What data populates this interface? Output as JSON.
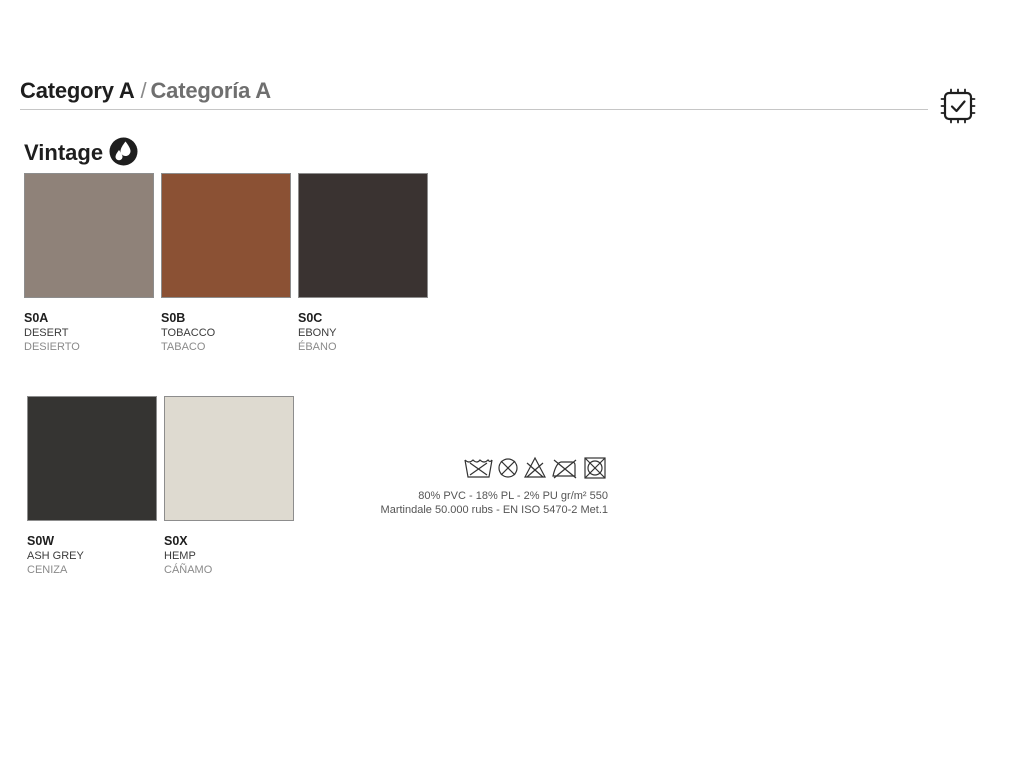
{
  "header": {
    "title_en": "Category A",
    "separator": "/",
    "title_es": "Categoría A",
    "certification_icon": "certified-check-icon"
  },
  "section": {
    "title": "Vintage",
    "icon": "water-repellent-icon"
  },
  "swatches": [
    {
      "code": "S0A",
      "name_en": "DESERT",
      "name_es": "DESIERTO",
      "color": "#8f8279"
    },
    {
      "code": "S0B",
      "name_en": "TOBACCO",
      "name_es": "TABACO",
      "color": "#8b5134"
    },
    {
      "code": "S0C",
      "name_en": "EBONY",
      "name_es": "ÉBANO",
      "color": "#3a3331"
    },
    {
      "code": "S0W",
      "name_en": "ASH GREY",
      "name_es": "CENIZA",
      "color": "#353432"
    },
    {
      "code": "S0X",
      "name_en": "HEMP",
      "name_es": "CÁÑAMO",
      "color": "#dedad0"
    }
  ],
  "care": {
    "icons": [
      "wash-30-icon",
      "no-tumble-dry-icon",
      "no-bleach-icon",
      "no-iron-icon",
      "no-dryclean-icon"
    ],
    "composition": "80% PVC - 18% PL - 2% PU   gr/m² 550",
    "martindale": "Martindale 50.000 rubs - EN ISO 5470-2 Met.1"
  }
}
